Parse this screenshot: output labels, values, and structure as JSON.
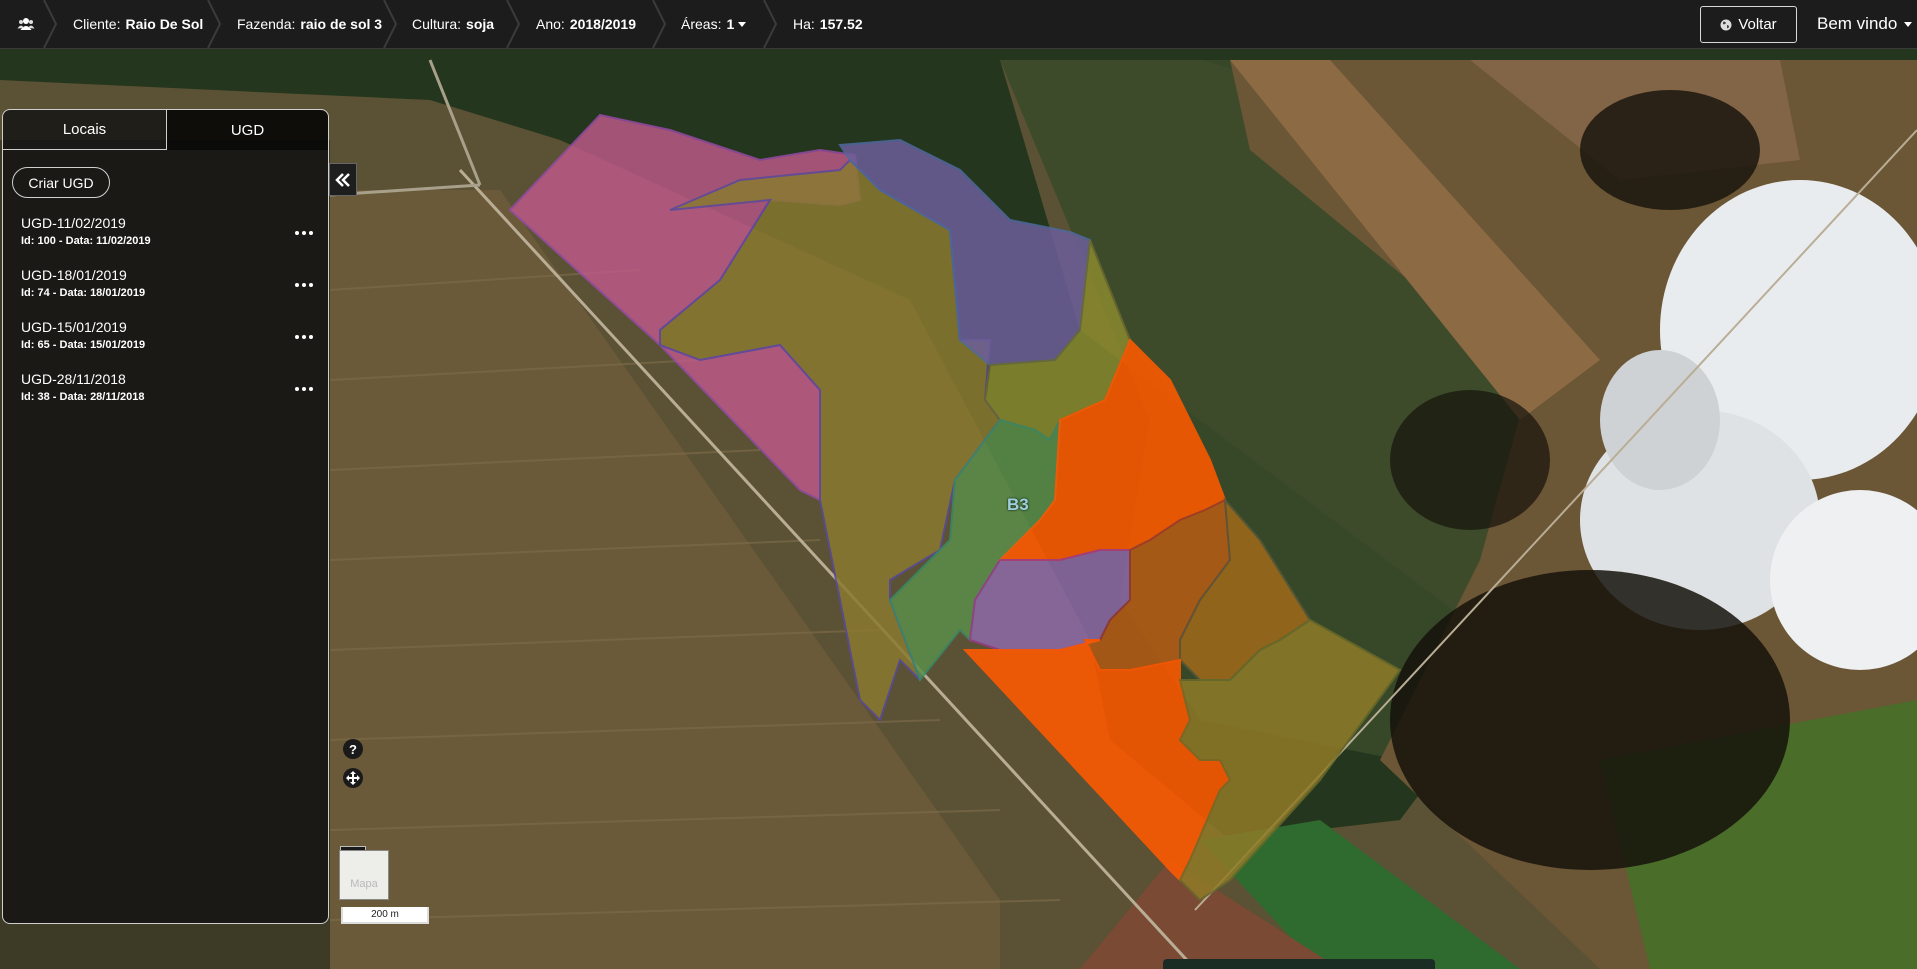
{
  "header": {
    "home_icon": "users-icon",
    "breadcrumbs": [
      {
        "label": "Cliente:",
        "value": "Raio De Sol"
      },
      {
        "label": "Fazenda:",
        "value": "raio de sol 3"
      },
      {
        "label": "Cultura:",
        "value": "soja"
      },
      {
        "label": "Ano:",
        "value": "2018/2019"
      },
      {
        "label": "Áreas:",
        "value": "1"
      },
      {
        "label": "Ha:",
        "value": "157.52"
      }
    ],
    "back_button": "Voltar",
    "user_menu": "Bem vindo"
  },
  "panel": {
    "tabs": [
      {
        "label": "Locais",
        "active": false
      },
      {
        "label": "UGD",
        "active": true
      }
    ],
    "create_button": "Criar UGD",
    "items": [
      {
        "title": "UGD-11/02/2019",
        "subtitle": "Id: 100 - Data: 11/02/2019"
      },
      {
        "title": "UGD-18/01/2019",
        "subtitle": "Id: 74 - Data: 18/01/2019"
      },
      {
        "title": "UGD-15/01/2019",
        "subtitle": "Id: 65 - Data: 15/01/2019"
      },
      {
        "title": "UGD-28/11/2018",
        "subtitle": "Id: 38 - Data: 28/11/2018"
      }
    ]
  },
  "map": {
    "field_label": "B3",
    "help": "?",
    "zoom_in": "+",
    "zoom_out": "−",
    "layer_thumb": "Mapa",
    "scale": "200 m",
    "zone_colors": [
      "#c05a8a",
      "#8a7a30",
      "#6d5f9a",
      "#5b8f4a",
      "#ff5a00",
      "#8d6aa8",
      "#b85d15",
      "#8f7b28"
    ]
  }
}
